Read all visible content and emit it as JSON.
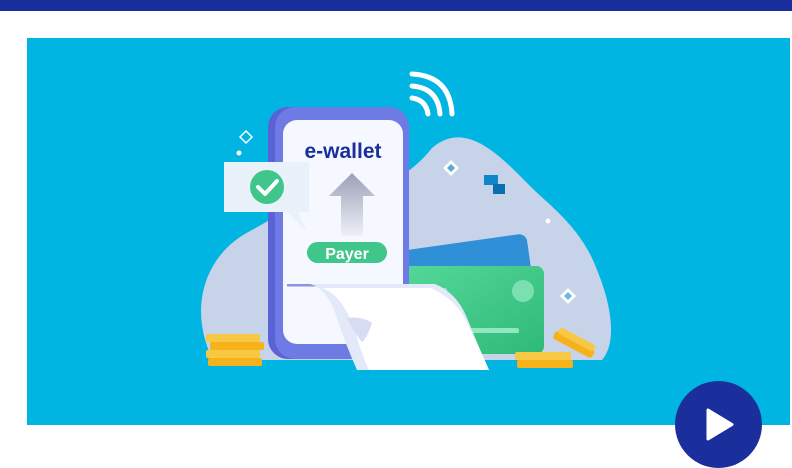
{
  "illustration": {
    "title": "e-wallet",
    "badge": "Payer",
    "icons": [
      "wifi-icon",
      "check-icon",
      "upload-arrow-icon",
      "receipt-icon",
      "card-icon",
      "coins-icon"
    ]
  },
  "player": {
    "play_icon": "play-icon"
  },
  "colors": {
    "brand_navy": "#1b2f9c",
    "banner_blue": "#00b5e2",
    "accent_green": "#3fc78b",
    "coin_gold": "#f5b21b"
  }
}
